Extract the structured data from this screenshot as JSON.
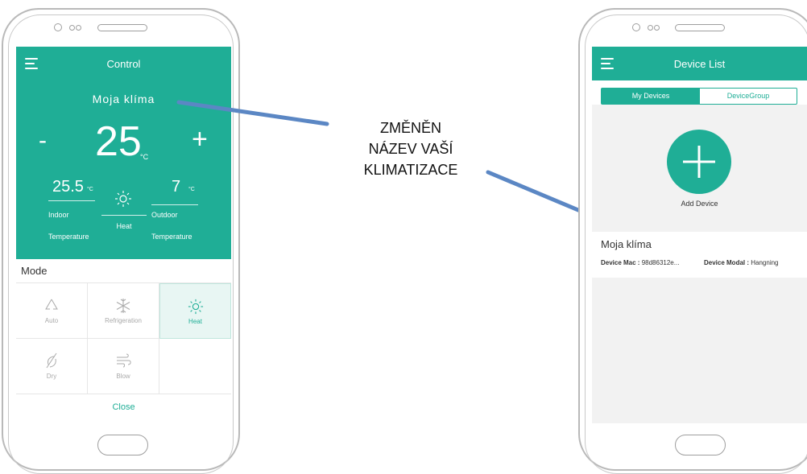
{
  "left_phone": {
    "header_title": "Control",
    "device_name": "Moja klíma",
    "temp_minus": "-",
    "temp_value": "25",
    "temp_unit": "°C",
    "temp_plus": "+",
    "indoor_value": "25.5",
    "indoor_unit": "°C",
    "indoor_label_1": "Indoor",
    "indoor_label_2": "Temperature",
    "mode_center_label": "Heat",
    "outdoor_value": "7",
    "outdoor_unit": "°C",
    "outdoor_label_1": "Outdoor",
    "outdoor_label_2": "Temperature",
    "mode_title": "Mode",
    "modes": [
      {
        "label": "Auto",
        "icon": "recycle-icon",
        "selected": false
      },
      {
        "label": "Refrigeration",
        "icon": "snowflake-icon",
        "selected": false
      },
      {
        "label": "Heat",
        "icon": "sun-icon",
        "selected": true
      },
      {
        "label": "Dry",
        "icon": "leaf-icon",
        "selected": false
      },
      {
        "label": "Blow",
        "icon": "wind-icon",
        "selected": false
      }
    ],
    "close_label": "Close"
  },
  "annotation": {
    "line1": "ZMĚNĚN",
    "line2": "NÁZEV VAŠÍ",
    "line3": "KLIMATIZACE"
  },
  "right_phone": {
    "header_title": "Device List",
    "tab_my_devices": "My Devices",
    "tab_device_group": "DeviceGroup",
    "add_device_label": "Add Device",
    "device": {
      "name": "Moja klíma",
      "mac_label": "Device Mac :",
      "mac_value": "98d86312e...",
      "modal_label": "Device Modal :",
      "modal_value": "Hangning"
    }
  },
  "colors": {
    "accent": "#1fae96",
    "selected_bg": "#e8f6f3",
    "arrow": "#5b87c4"
  }
}
